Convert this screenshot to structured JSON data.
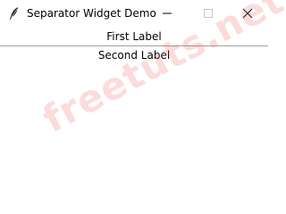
{
  "window": {
    "title": "Separator Widget Demo"
  },
  "labels": {
    "first": "First Label",
    "second": "Second Label"
  },
  "watermark": "freetuts.net",
  "icons": {
    "app": "feather-icon",
    "minimize": "minimize-icon",
    "maximize": "maximize-icon",
    "close": "close-icon"
  }
}
